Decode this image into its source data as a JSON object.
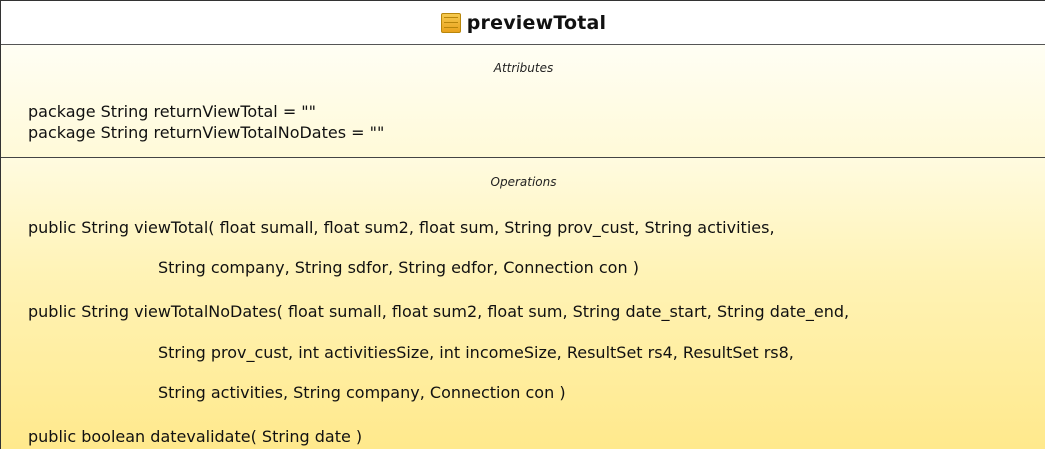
{
  "class": {
    "name": "previewTotal",
    "icon": "class-icon"
  },
  "attributes": {
    "title": "Attributes",
    "items": [
      "package String returnViewTotal = \"\"",
      "package String returnViewTotalNoDates = \"\""
    ]
  },
  "operations": {
    "title": "Operations",
    "items": [
      {
        "signature": "public String  viewTotal( float sumall, float sum2, float sum, String prov_cust, String activities,",
        "continuation": [
          "String company, String sdfor, String edfor, Connection con )"
        ]
      },
      {
        "signature": "public String  viewTotalNoDates( float sumall, float sum2, float sum, String date_start, String date_end,",
        "continuation": [
          "String prov_cust, int activitiesSize, int incomeSize, ResultSet rs4, ResultSet rs8,",
          "String activities, String company, Connection con )"
        ]
      },
      {
        "signature": "public boolean  datevalidate( String date )",
        "continuation": []
      }
    ]
  }
}
